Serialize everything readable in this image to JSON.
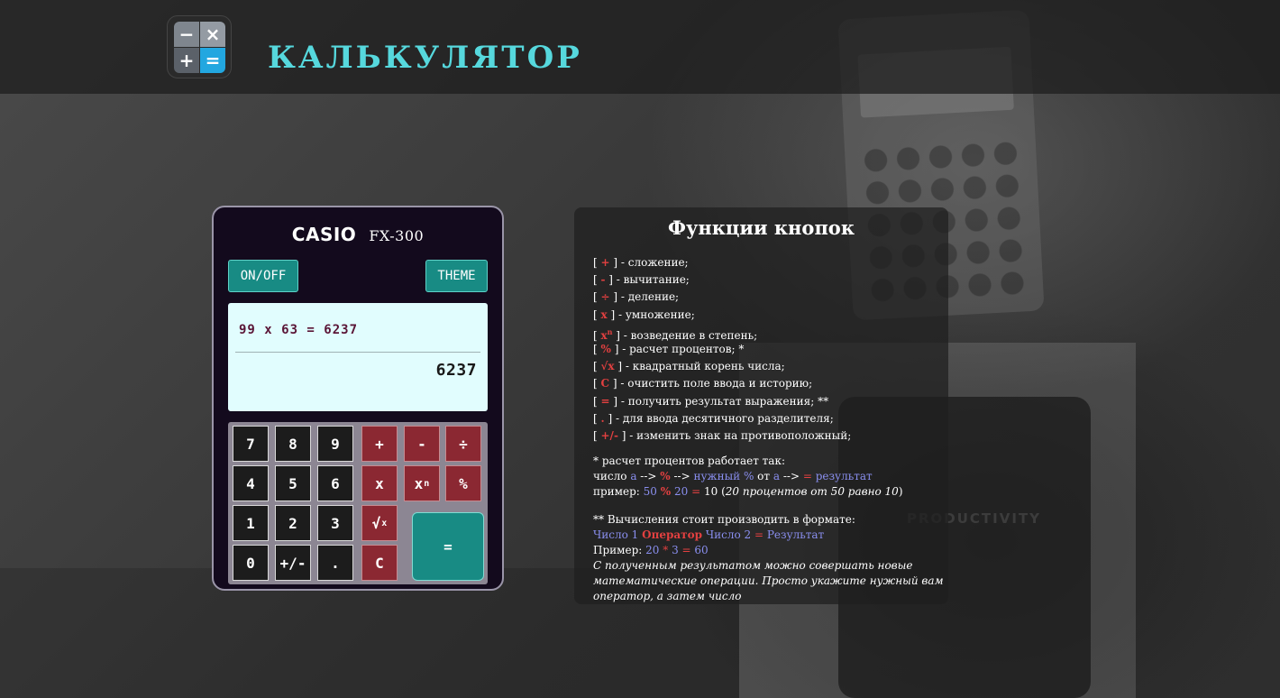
{
  "header": {
    "logo_icons": {
      "tl": "−",
      "tr": "×",
      "bl": "+",
      "br": "="
    },
    "title": "КАЛЬКУЛЯТОР"
  },
  "calculator": {
    "brand": "CASIO",
    "model": "FX-300",
    "onoff_label": "ON/OFF",
    "theme_label": "THEME",
    "display": {
      "history": "99 x 63 = 6237",
      "result": "6237"
    },
    "keys": {
      "k7": "7",
      "k8": "8",
      "k9": "9",
      "k4": "4",
      "k5": "5",
      "k6": "6",
      "k1": "1",
      "k2": "2",
      "k3": "3",
      "k0": "0",
      "sign": "+/-",
      "dot": ".",
      "plus": "+",
      "minus": "-",
      "divide": "÷",
      "multiply": "x",
      "power_base": "x",
      "power_exp": "n",
      "percent": "%",
      "sqrt_symbol": "√",
      "sqrt_sub": "x",
      "clear": "C",
      "equals": "="
    }
  },
  "help": {
    "title": "Функции кнопок",
    "items": [
      {
        "symbol": "+",
        "text": " - сложение;"
      },
      {
        "symbol": "-",
        "text": " - вычитание;"
      },
      {
        "symbol": "÷",
        "text": " - деление;"
      },
      {
        "symbol": "x",
        "text": " - умножение;"
      },
      {
        "symbol": "x",
        "symbol_sup": "n",
        "text": " - возведение в степень;"
      },
      {
        "symbol": "%",
        "text": " - расчет процентов; *"
      },
      {
        "symbol": "√x",
        "text": " - квадратный корень числа;"
      },
      {
        "symbol": "C",
        "text": " - очистить поле ввода и историю;"
      },
      {
        "symbol": "=",
        "text": " - получить результат выражения; **"
      },
      {
        "symbol": ".",
        "text": " - для ввода десятичного разделителя;"
      },
      {
        "symbol": "+/-",
        "text": " - изменить знак на противоположный;"
      }
    ],
    "percent_note": {
      "heading": "* расчет процентов работает так:",
      "formula": {
        "prefix": "число ",
        "a": "a",
        "arrow1": " --> ",
        "pct": "%",
        "arrow2": " --> ",
        "needed": "нужный %",
        "ot": " от ",
        "a2": "a",
        "arrow3": " --> ",
        "eq": "=",
        "result": " результат"
      },
      "example": {
        "prefix": "пример: ",
        "n1": "50",
        "pct": "%",
        "n2": "20",
        "eq": "=",
        "res": " 10 (",
        "ital": "20 процентов от 50 равно 10",
        "close": ")"
      }
    },
    "format_note": {
      "heading": "** Вычисления стоит производить в формате:",
      "format": {
        "n1": "Число 1",
        "op": "Оператор",
        "n2": "Число 2",
        "eq": "=",
        "res": "Результат"
      },
      "example": {
        "prefix": "Пример: ",
        "n1": "20",
        "op": "*",
        "n2": "3",
        "eq": "=",
        "res": "60"
      },
      "footer": "С полученным результатом можно совершать новые математические операции. Просто укажите нужный вам оператор, а затем число"
    }
  },
  "background": {
    "notebook_text": "PRODUCTIVITY"
  },
  "colors": {
    "accent_teal": "#188b84",
    "title_cyan": "#56d8dd",
    "operator_red": "#8b2832",
    "display_bg": "#e1fdfe",
    "help_symbol_red": "#e24040",
    "help_variable_blue": "#8a8ff0"
  }
}
